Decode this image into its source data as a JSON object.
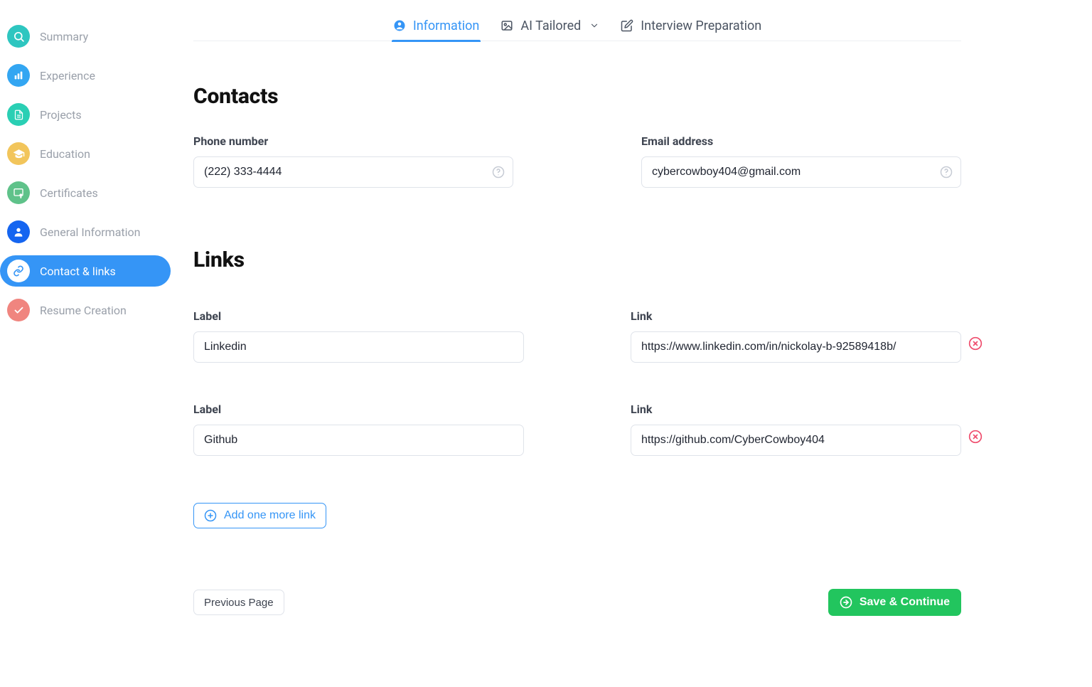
{
  "sidebar": {
    "items": [
      {
        "label": "Summary",
        "icon": "search-icon",
        "color": "#2ec6c0",
        "active": false
      },
      {
        "label": "Experience",
        "icon": "bar-chart-icon",
        "color": "#33a6f2",
        "active": false
      },
      {
        "label": "Projects",
        "icon": "document-icon",
        "color": "#2acfb4",
        "active": false
      },
      {
        "label": "Education",
        "icon": "graduation-icon",
        "color": "#f2c55b",
        "active": false
      },
      {
        "label": "Certificates",
        "icon": "certificate-icon",
        "color": "#5fc28a",
        "active": false
      },
      {
        "label": "General Information",
        "icon": "person-icon",
        "color": "#1565f0",
        "active": false
      },
      {
        "label": "Contact & links",
        "icon": "link-icon",
        "color": "#3595f6",
        "active": true
      },
      {
        "label": "Resume Creation",
        "icon": "check-icon",
        "color": "#f0857f",
        "active": false
      }
    ]
  },
  "tabs": {
    "information": "Information",
    "ai_tailored": "AI Tailored",
    "interview_prep": "Interview Preparation"
  },
  "sections": {
    "contacts_title": "Contacts",
    "links_title": "Links"
  },
  "contacts": {
    "phone_label": "Phone number",
    "phone_value": "(222) 333-4444",
    "email_label": "Email address",
    "email_value": "cybercowboy404@gmail.com"
  },
  "link_labels": {
    "label_heading": "Label",
    "link_heading": "Link"
  },
  "links": [
    {
      "label": "Linkedin",
      "url": "https://www.linkedin.com/in/nickolay-b-92589418b/"
    },
    {
      "label": "Github",
      "url": "https://github.com/CyberCowboy404"
    }
  ],
  "buttons": {
    "add_link": "Add one more link",
    "prev": "Previous Page",
    "save": "Save & Continue"
  }
}
